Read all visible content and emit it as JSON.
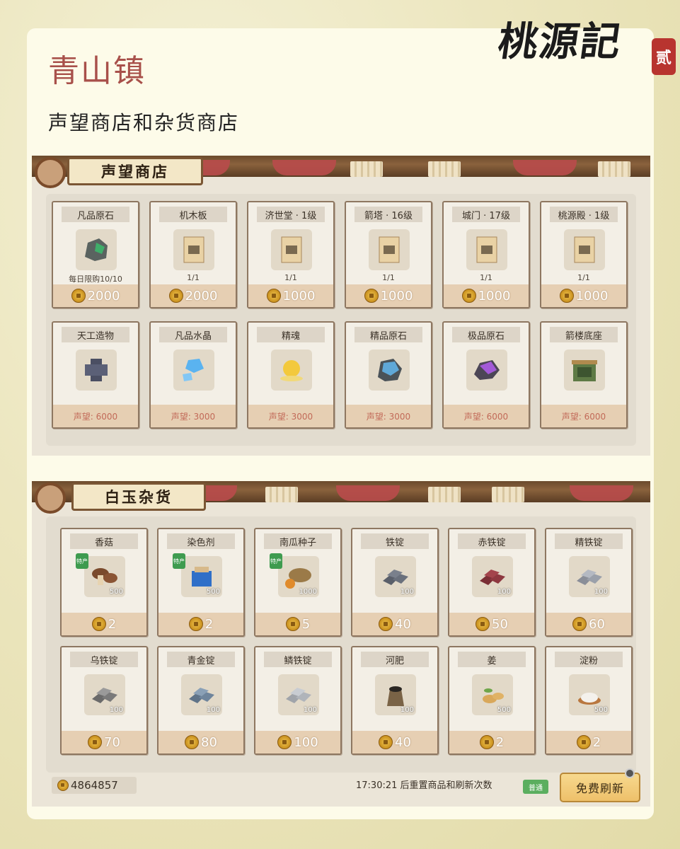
{
  "logo": {
    "text": "桃源記",
    "seal": "贰"
  },
  "header": {
    "title": "青山镇",
    "subtitle": "声望商店和杂货商店"
  },
  "reputation_shop": {
    "title": "声望商店",
    "row1": [
      {
        "name": "凡品原石",
        "sub": "每日限购10/10",
        "price": "2000",
        "icon": "raw-stone-icon"
      },
      {
        "name": "机木板",
        "sub": "1/1",
        "price": "2000",
        "icon": "blueprint-icon"
      },
      {
        "name": "济世堂 · 1级",
        "sub": "1/1",
        "price": "1000",
        "icon": "blueprint-icon"
      },
      {
        "name": "箭塔 · 16级",
        "sub": "1/1",
        "price": "1000",
        "icon": "blueprint-icon"
      },
      {
        "name": "城门 · 17级",
        "sub": "1/1",
        "price": "1000",
        "icon": "blueprint-icon"
      },
      {
        "name": "桃源殿 · 1级",
        "sub": "1/1",
        "price": "1000",
        "icon": "blueprint-icon"
      }
    ],
    "row2": [
      {
        "name": "天工造物",
        "price": "声望: 6000",
        "icon": "crafting-block-icon"
      },
      {
        "name": "凡品水晶",
        "price": "声望: 3000",
        "icon": "crystal-icon"
      },
      {
        "name": "精魂",
        "price": "声望: 3000",
        "icon": "spirit-orb-icon"
      },
      {
        "name": "精品原石",
        "price": "声望: 3000",
        "icon": "fine-stone-icon"
      },
      {
        "name": "极品原石",
        "price": "声望: 6000",
        "icon": "premium-stone-icon"
      },
      {
        "name": "箭楼底座",
        "price": "声望: 6000",
        "icon": "tower-base-icon"
      }
    ]
  },
  "grocery_shop": {
    "title": "白玉杂货",
    "row1": [
      {
        "name": "香菇",
        "qty": "500",
        "price": "2",
        "tag": "特产",
        "icon": "mushroom-icon"
      },
      {
        "name": "染色剂",
        "qty": "500",
        "price": "2",
        "tag": "特产",
        "icon": "dye-icon"
      },
      {
        "name": "南瓜种子",
        "qty": "1000",
        "price": "5",
        "tag": "特产",
        "icon": "pumpkin-seed-icon"
      },
      {
        "name": "铁锭",
        "qty": "100",
        "price": "40",
        "icon": "iron-ingot-icon"
      },
      {
        "name": "赤铁锭",
        "qty": "100",
        "price": "50",
        "icon": "red-iron-ingot-icon"
      },
      {
        "name": "精铁锭",
        "qty": "100",
        "price": "60",
        "icon": "fine-iron-ingot-icon"
      }
    ],
    "row2": [
      {
        "name": "乌铁锭",
        "qty": "100",
        "price": "70",
        "icon": "black-iron-ingot-icon"
      },
      {
        "name": "青金锭",
        "qty": "100",
        "price": "80",
        "icon": "azure-ingot-icon"
      },
      {
        "name": "鳞铁锭",
        "qty": "100",
        "price": "100",
        "icon": "scale-iron-ingot-icon"
      },
      {
        "name": "河肥",
        "qty": "100",
        "price": "40",
        "icon": "fertilizer-icon"
      },
      {
        "name": "姜",
        "qty": "500",
        "price": "2",
        "icon": "ginger-icon"
      },
      {
        "name": "淀粉",
        "qty": "500",
        "price": "2",
        "icon": "starch-icon"
      }
    ],
    "balance": "4864857",
    "reset_text": "17:30:21 后重置商品和刷新次数",
    "badge": "普通",
    "refresh_label": "免费刷新"
  },
  "colors": {
    "title_red": "#a8504a",
    "price_bar": "#e6cfb3",
    "reputation_text": "#c26a58"
  }
}
